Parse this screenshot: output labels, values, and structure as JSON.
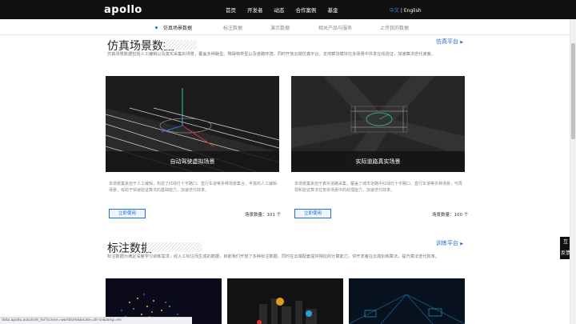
{
  "nav": {
    "logo": "apollo",
    "links": [
      "首页",
      "开发者",
      "动态",
      "合作案例",
      "基金"
    ],
    "lang_active": "中文",
    "lang_sep": " | ",
    "lang_other": "English"
  },
  "subnav": {
    "items": [
      "仿真场景数据",
      "标注数据",
      "演示数据",
      "相关产品与服务",
      "上传我的数据"
    ]
  },
  "section1": {
    "title": "仿真场景数据",
    "link": "仿真平台",
    "desc": "仿真场景数据包括人工编辑以及真实采集的场景，覆盖多种路型、障碍物类型以及道路环境，同时开放云端仿真平台，支持算法模块在多场景中并发在线验证，加速算法迭代速度。",
    "cards": [
      {
        "caption": "自动驾驶虚拟场景",
        "desc": "本场景集来自于人工编辑，构造了红绿灯十字路口、直行车道等多种场景集合，丰富的人工编辑场景，有助于快速验证算法的基础能力，加速迭代效率。",
        "button": "立即使用",
        "count": "场景数量：101 个"
      },
      {
        "caption": "实际道路真实场景",
        "desc": "本场景集来自于真实道路采集，覆盖了城市道路中红绿灯十字路口、直行车道等多种场景，可再现和验证算法在复杂场景中的处理能力，加速迭代效率。",
        "button": "立即使用",
        "count": "场景数量：100 个"
      }
    ]
  },
  "section2": {
    "title": "标注数据",
    "link": "训练平台",
    "desc": "标注数据为满足深度学习训练需求，经人工标注而生成的数据，目前我们开放了多种标注数据，同时在云端配套提供相应的计算能力，供开发者在云端训练算法，提升算法迭代效率。"
  },
  "float": {
    "top": "互",
    "bottom": "反馈"
  },
  "status_url": "data.apollo.auto/sim_for?scene=worldsim&locale=zh-cn&lang=en"
}
